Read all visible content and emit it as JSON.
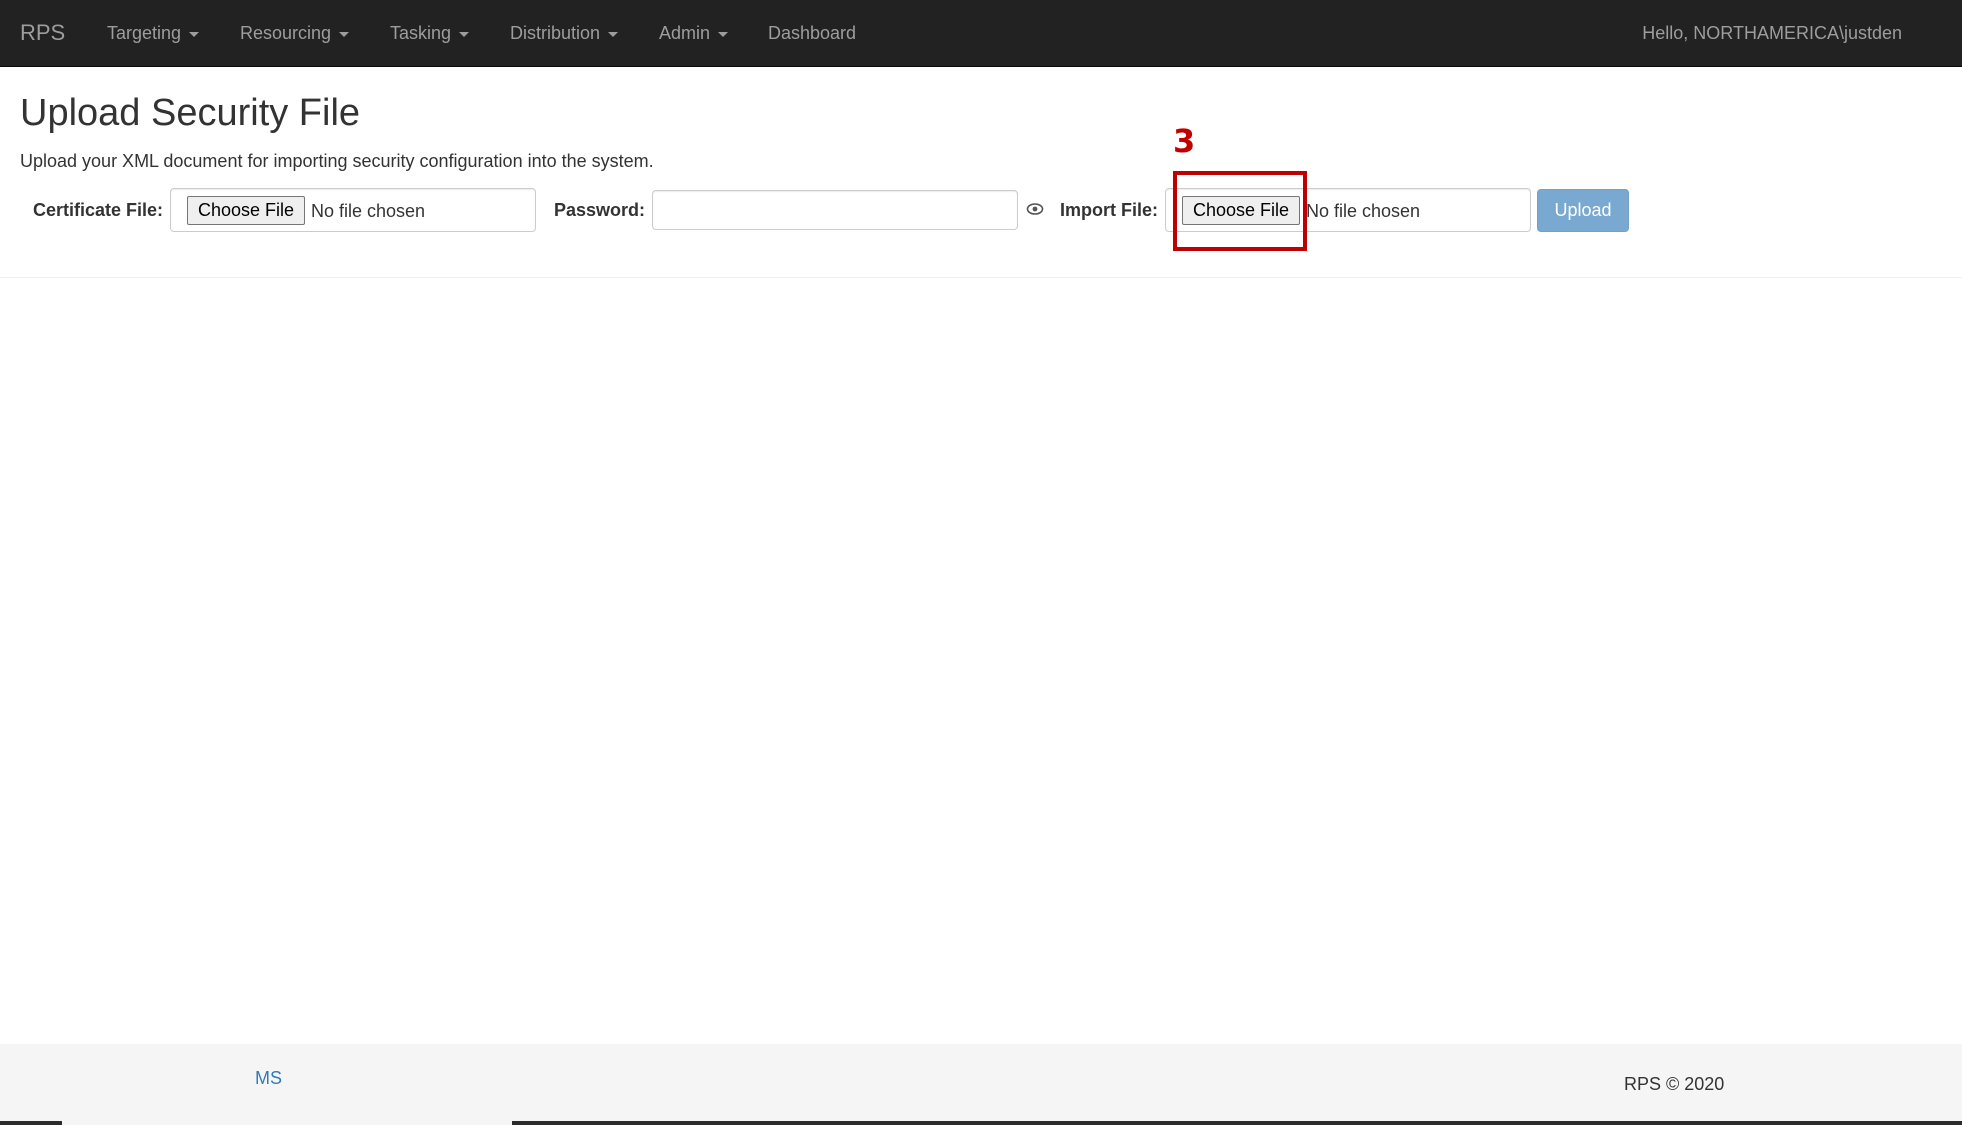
{
  "navbar": {
    "brand": "RPS",
    "items": [
      {
        "label": "Targeting",
        "dropdown": true
      },
      {
        "label": "Resourcing",
        "dropdown": true
      },
      {
        "label": "Tasking",
        "dropdown": true
      },
      {
        "label": "Distribution",
        "dropdown": true
      },
      {
        "label": "Admin",
        "dropdown": true
      },
      {
        "label": "Dashboard",
        "dropdown": false
      }
    ],
    "user_greeting": "Hello, NORTHAMERICA\\justden"
  },
  "page": {
    "title": "Upload Security File",
    "description": "Upload your XML document for importing security configuration into the system."
  },
  "form": {
    "certificate_label": "Certificate File:",
    "certificate_button": "Choose File",
    "certificate_status": "No file chosen",
    "password_label": "Password:",
    "password_value": "",
    "import_label": "Import File:",
    "import_button": "Choose File",
    "import_status": "No file chosen",
    "upload_label": "Upload"
  },
  "annotation": {
    "step_number": "3",
    "color": "#c00000"
  },
  "footer": {
    "link": "MS",
    "copyright": "RPS © 2020"
  },
  "colors": {
    "navbar_bg": "#222222",
    "navbar_text": "#9d9d9d",
    "primary": "#337ab7",
    "footer_bg": "#f5f5f5"
  }
}
